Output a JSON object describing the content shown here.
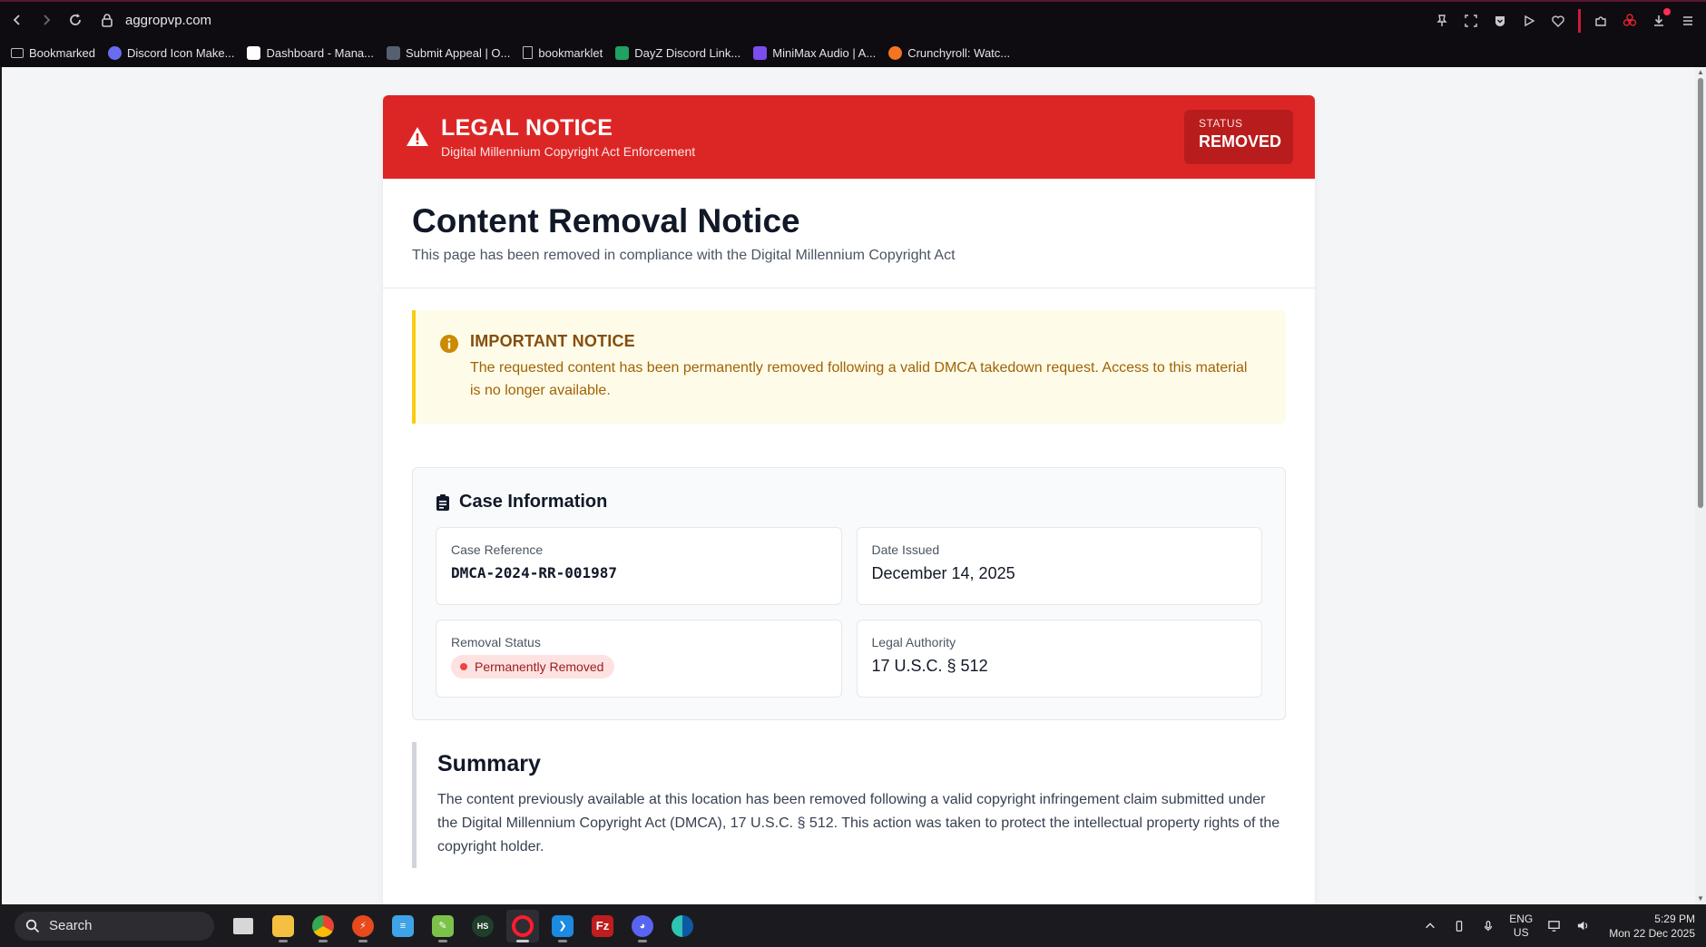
{
  "browser": {
    "url": "aggropvp.com",
    "bookmarks": [
      {
        "label": "Bookmarked",
        "icon": "folder-icon",
        "color": "#bbbbbb"
      },
      {
        "label": "Discord Icon Make...",
        "icon": "discord-icon",
        "color": "#6a6cf0"
      },
      {
        "label": "Dashboard - Mana...",
        "icon": "flame-icon",
        "color": "#ffffff"
      },
      {
        "label": "Submit Appeal | O...",
        "icon": "appeal-icon",
        "color": "#556070"
      },
      {
        "label": "bookmarklet",
        "icon": "page-icon",
        "color": "#bbbbbb"
      },
      {
        "label": "DayZ Discord Link...",
        "icon": "sheet-icon",
        "color": "#1ea362"
      },
      {
        "label": "MiniMax Audio | A...",
        "icon": "minimax-icon",
        "color": "#7b4cf0"
      },
      {
        "label": "Crunchyroll: Watc...",
        "icon": "crunchyroll-icon",
        "color": "#f47521"
      }
    ]
  },
  "page": {
    "banner": {
      "title": "LEGAL NOTICE",
      "subtitle": "Digital Millennium Copyright Act Enforcement",
      "status_label": "STATUS",
      "status_value": "REMOVED",
      "color": "#dc2626"
    },
    "heading": "Content Removal Notice",
    "subheading": "This page has been removed in compliance with the Digital Millennium Copyright Act",
    "notice": {
      "title": "IMPORTANT NOTICE",
      "text": "The requested content has been permanently removed following a valid DMCA takedown request. Access to this material is no longer available."
    },
    "case": {
      "title": "Case Information",
      "reference_label": "Case Reference",
      "reference_value": "DMCA-2024-RR-001987",
      "date_label": "Date Issued",
      "date_value": "December 14, 2025",
      "status_label": "Removal Status",
      "status_value": "Permanently Removed",
      "authority_label": "Legal Authority",
      "authority_value": "17 U.S.C. § 512"
    },
    "summary": {
      "title": "Summary",
      "text": "The content previously available at this location has been removed following a valid copyright infringement claim submitted under the Digital Millennium Copyright Act (DMCA), 17 U.S.C. § 512. This action was taken to protect the intellectual property rights of the copyright holder."
    }
  },
  "taskbar": {
    "search_label": "Search",
    "lang_top": "ENG",
    "lang_bottom": "US",
    "time": "5:29 PM",
    "date": "Mon 22 Dec 2025"
  }
}
